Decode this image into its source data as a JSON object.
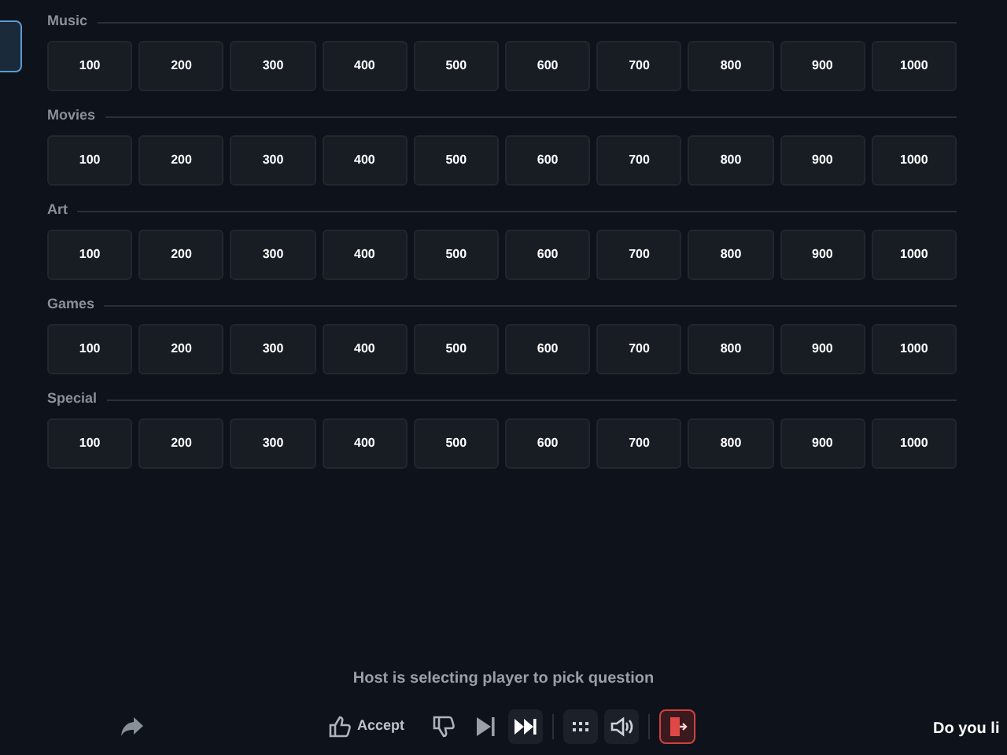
{
  "categories": [
    {
      "name": "Music",
      "values": [
        "100",
        "200",
        "300",
        "400",
        "500",
        "600",
        "700",
        "800",
        "900",
        "1000"
      ]
    },
    {
      "name": "Movies",
      "values": [
        "100",
        "200",
        "300",
        "400",
        "500",
        "600",
        "700",
        "800",
        "900",
        "1000"
      ]
    },
    {
      "name": "Art",
      "values": [
        "100",
        "200",
        "300",
        "400",
        "500",
        "600",
        "700",
        "800",
        "900",
        "1000"
      ]
    },
    {
      "name": "Games",
      "values": [
        "100",
        "200",
        "300",
        "400",
        "500",
        "600",
        "700",
        "800",
        "900",
        "1000"
      ]
    },
    {
      "name": "Special",
      "values": [
        "100",
        "200",
        "300",
        "400",
        "500",
        "600",
        "700",
        "800",
        "900",
        "1000"
      ]
    }
  ],
  "status": "Host is selecting player to pick question",
  "toolbar": [
    {
      "kind": "accept",
      "label": "Accept"
    },
    {
      "kind": "dislike"
    },
    {
      "kind": "skip"
    },
    {
      "kind": "fast-forward"
    },
    {
      "kind": "divider"
    },
    {
      "kind": "grid"
    },
    {
      "kind": "volume"
    },
    {
      "kind": "divider"
    },
    {
      "kind": "exit"
    }
  ],
  "question_preview": "Do you li"
}
